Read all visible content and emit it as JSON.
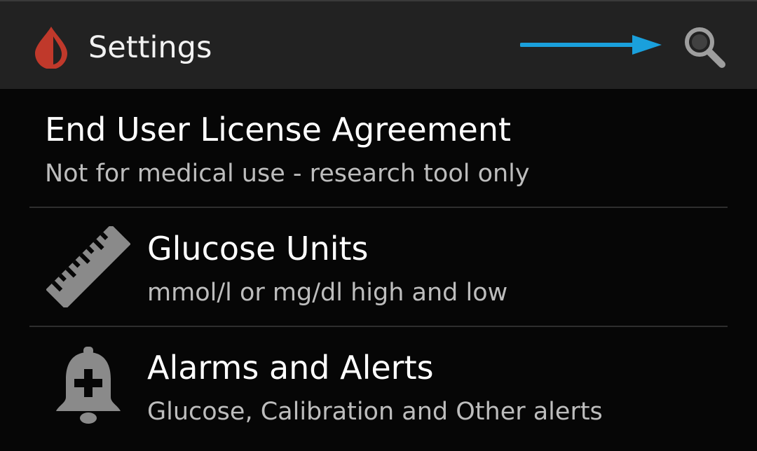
{
  "action_bar": {
    "title": "Settings",
    "app_icon": "blood-drop-icon",
    "search_icon": "search-icon",
    "annotation": "arrow-right-icon",
    "colors": {
      "background": "#222222",
      "drop": "#c0392b",
      "arrow": "#1aa0dc",
      "search": "#9e9e9e"
    }
  },
  "settings": {
    "eula": {
      "title": "End User License Agreement",
      "subtitle": "Not for medical use - research tool only"
    },
    "glucose_units": {
      "icon": "ruler-icon",
      "title": "Glucose Units",
      "subtitle": "mmol/l or mg/dl high and low"
    },
    "alarms": {
      "icon": "bell-plus-icon",
      "title": "Alarms and Alerts",
      "subtitle": "Glucose, Calibration and Other alerts"
    }
  }
}
